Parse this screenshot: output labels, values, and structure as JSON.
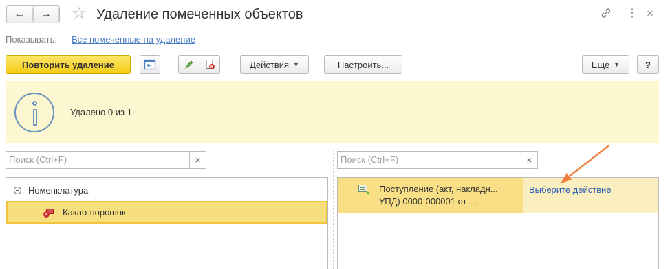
{
  "header": {
    "back_icon": "arrow-left-icon",
    "forward_icon": "arrow-right-icon",
    "favorite_icon": "star-icon",
    "title": "Удаление помеченных объектов",
    "link_icon": "link-icon",
    "more_icon": "more-vertical-icon",
    "close_icon": "close-icon"
  },
  "show_row": {
    "label": "Показывать:",
    "value": "Все помеченные на удаление"
  },
  "toolbar": {
    "retry_label": "Повторить удаление",
    "actions_label": "Действия",
    "configure_label": "Настроить...",
    "more_label": "Еще",
    "help_label": "?"
  },
  "info": {
    "icon": "info-icon",
    "message": "Удалено 0 из 1."
  },
  "left_panel": {
    "search_placeholder": "Поиск (Ctrl+F)",
    "clear_label": "×",
    "group_label": "Номенклатура",
    "item_label": "Какао-порошок"
  },
  "right_panel": {
    "search_placeholder": "Поиск (Ctrl+F)",
    "clear_label": "×",
    "doc_line1": "Поступление (акт, накладн...",
    "doc_line2": "УПД) 0000-000001 от ...",
    "action_label": "Выберите действие"
  },
  "colors": {
    "primary_button": "#f4cd16",
    "info_background": "#fcf6d1",
    "selection": "#f8df7e",
    "link": "#4a7ec3",
    "annotation_arrow": "#f08040"
  }
}
